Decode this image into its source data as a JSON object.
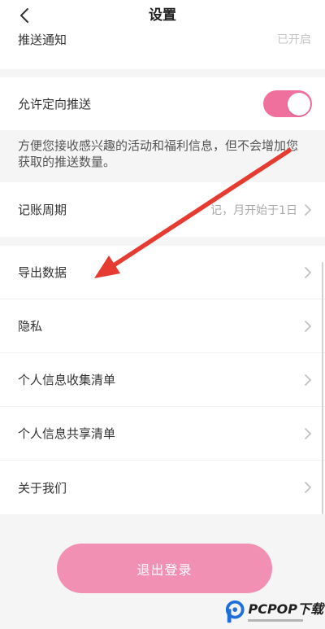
{
  "header": {
    "back_icon": "chevron-left-icon",
    "title": "设置"
  },
  "push_notification": {
    "label": "推送通知",
    "value": "已开启"
  },
  "targeted_push": {
    "label": "允许定向推送",
    "enabled": true,
    "toggle_color": "#ef6f9d"
  },
  "targeted_push_description": "方便您接收感兴趣的活动和福利信息，但不会增加您获取的推送数量。",
  "billing_cycle": {
    "label": "记账周期",
    "value": "记，月开始于1日",
    "icon": "chevron-right-icon"
  },
  "menu": [
    {
      "label": "导出数据",
      "icon": "chevron-right-icon"
    },
    {
      "label": "隐私",
      "icon": "chevron-right-icon"
    },
    {
      "label": "个人信息收集清单",
      "icon": "chevron-right-icon"
    },
    {
      "label": "个人信息共享清单",
      "icon": "chevron-right-icon"
    },
    {
      "label": "关于我们",
      "icon": "chevron-right-icon"
    }
  ],
  "logout": {
    "label": "退出登录",
    "color": "#f290b4"
  },
  "annotation": {
    "icon": "red-arrow-icon",
    "color": "#e63b31"
  },
  "watermark": {
    "text": "PCPOP下载",
    "logo_color": "#1e6fd9"
  }
}
